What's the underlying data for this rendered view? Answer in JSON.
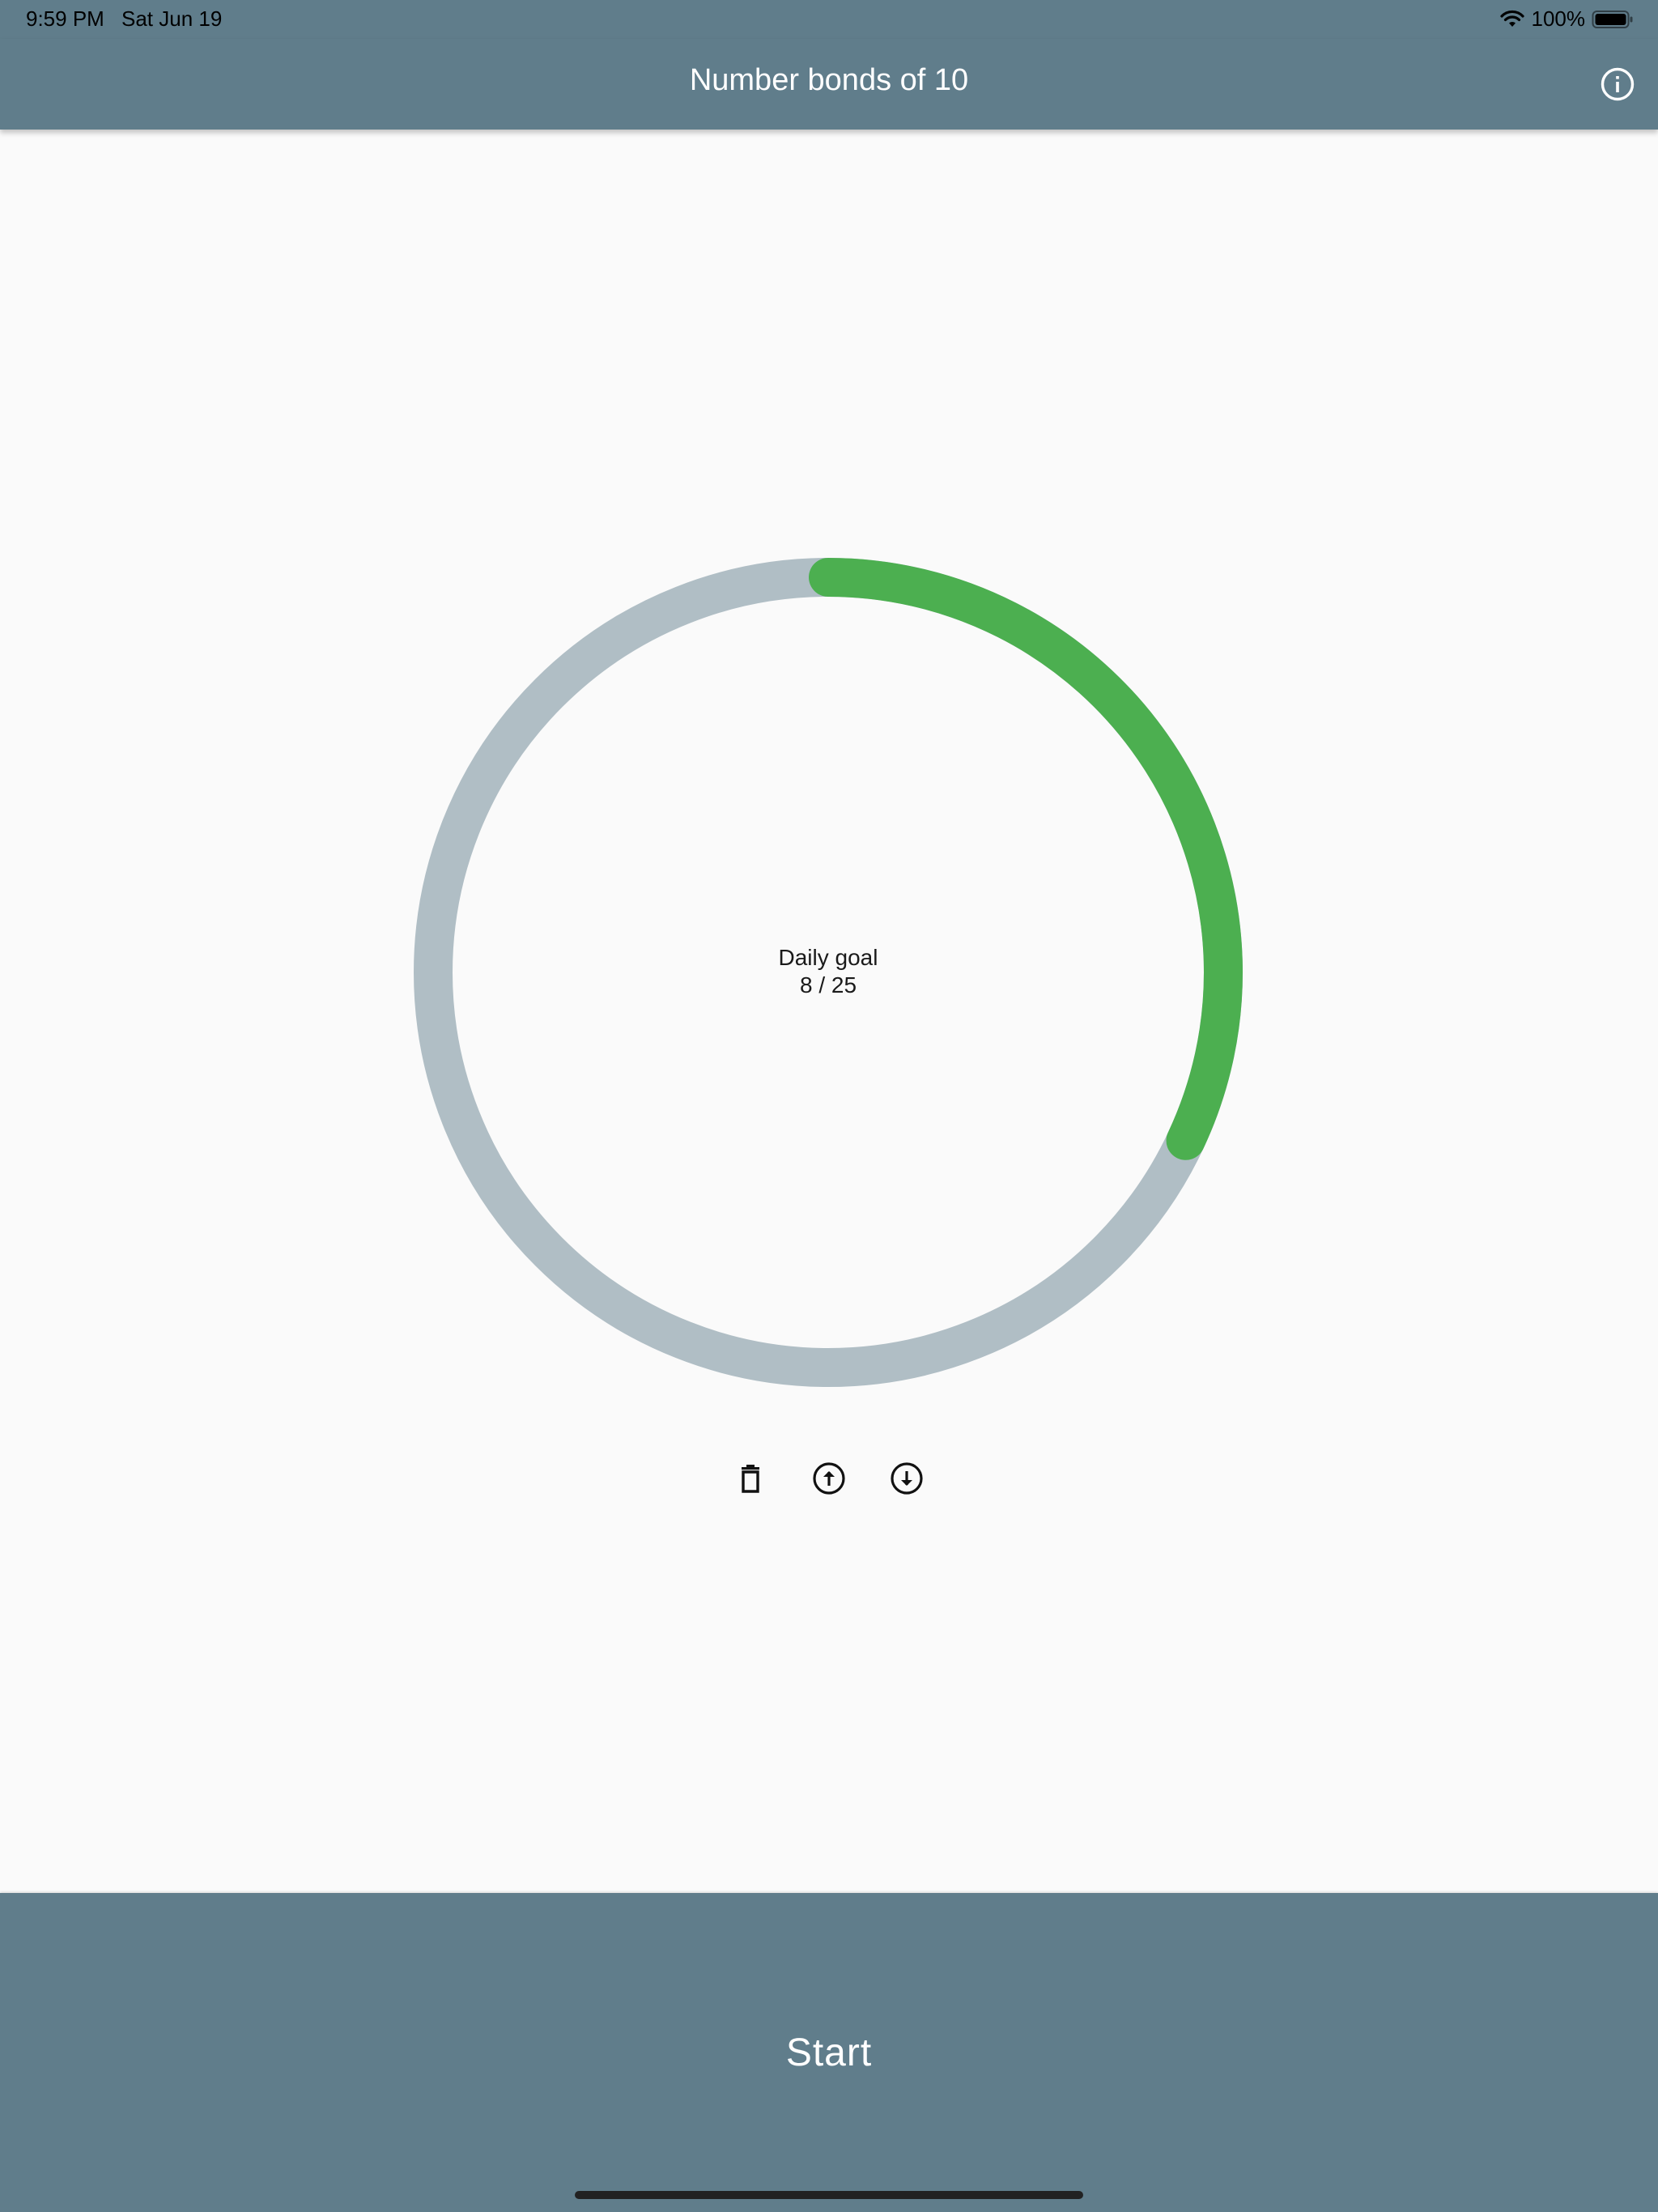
{
  "status_bar": {
    "time": "9:59 PM",
    "date": "Sat Jun 19",
    "battery": "100%",
    "wifi_icon": "wifi-icon",
    "battery_icon": "battery-full-icon"
  },
  "app_bar": {
    "title": "Number bonds of 10",
    "info_icon": "info-icon"
  },
  "progress": {
    "label": "Daily goal",
    "done": 8,
    "goal": 25,
    "text": "8 / 25",
    "fraction": 0.32
  },
  "actions": [
    {
      "name": "delete-button",
      "icon": "trash-icon"
    },
    {
      "name": "increase-goal-button",
      "icon": "arrow-up-circle-icon"
    },
    {
      "name": "decrease-goal-button",
      "icon": "arrow-down-circle-icon"
    }
  ],
  "start_button": {
    "label": "Start"
  },
  "colors": {
    "primary": "#607d8b",
    "progress": "#4caf50",
    "track": "#b0bec5",
    "background": "#fafafa"
  }
}
